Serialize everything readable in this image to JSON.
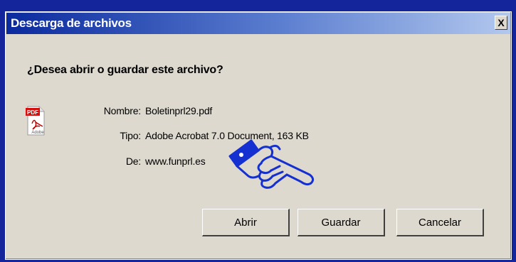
{
  "window": {
    "title": "Descarga de archivos",
    "close_label": "X"
  },
  "dialog": {
    "question": "¿Desea abrir o guardar este archivo?",
    "file": {
      "name_label": "Nombre:",
      "name_value": "Boletinprl29.pdf",
      "type_label": "Tipo:",
      "type_value": "Adobe Acrobat 7.0 Document, 163 KB",
      "from_label": "De:",
      "from_value": "www.funprl.es"
    },
    "icon_text": {
      "badge": "PDF",
      "brand": "Adobe"
    }
  },
  "buttons": {
    "open_label": "Abrir",
    "save_label": "Guardar",
    "cancel_label": "Cancelar"
  },
  "colors": {
    "titlebar_start": "#0a2a9e",
    "dialog_bg": "#ddd9cf",
    "frame": "#14249a",
    "pointer_hand": "#1530d0"
  }
}
